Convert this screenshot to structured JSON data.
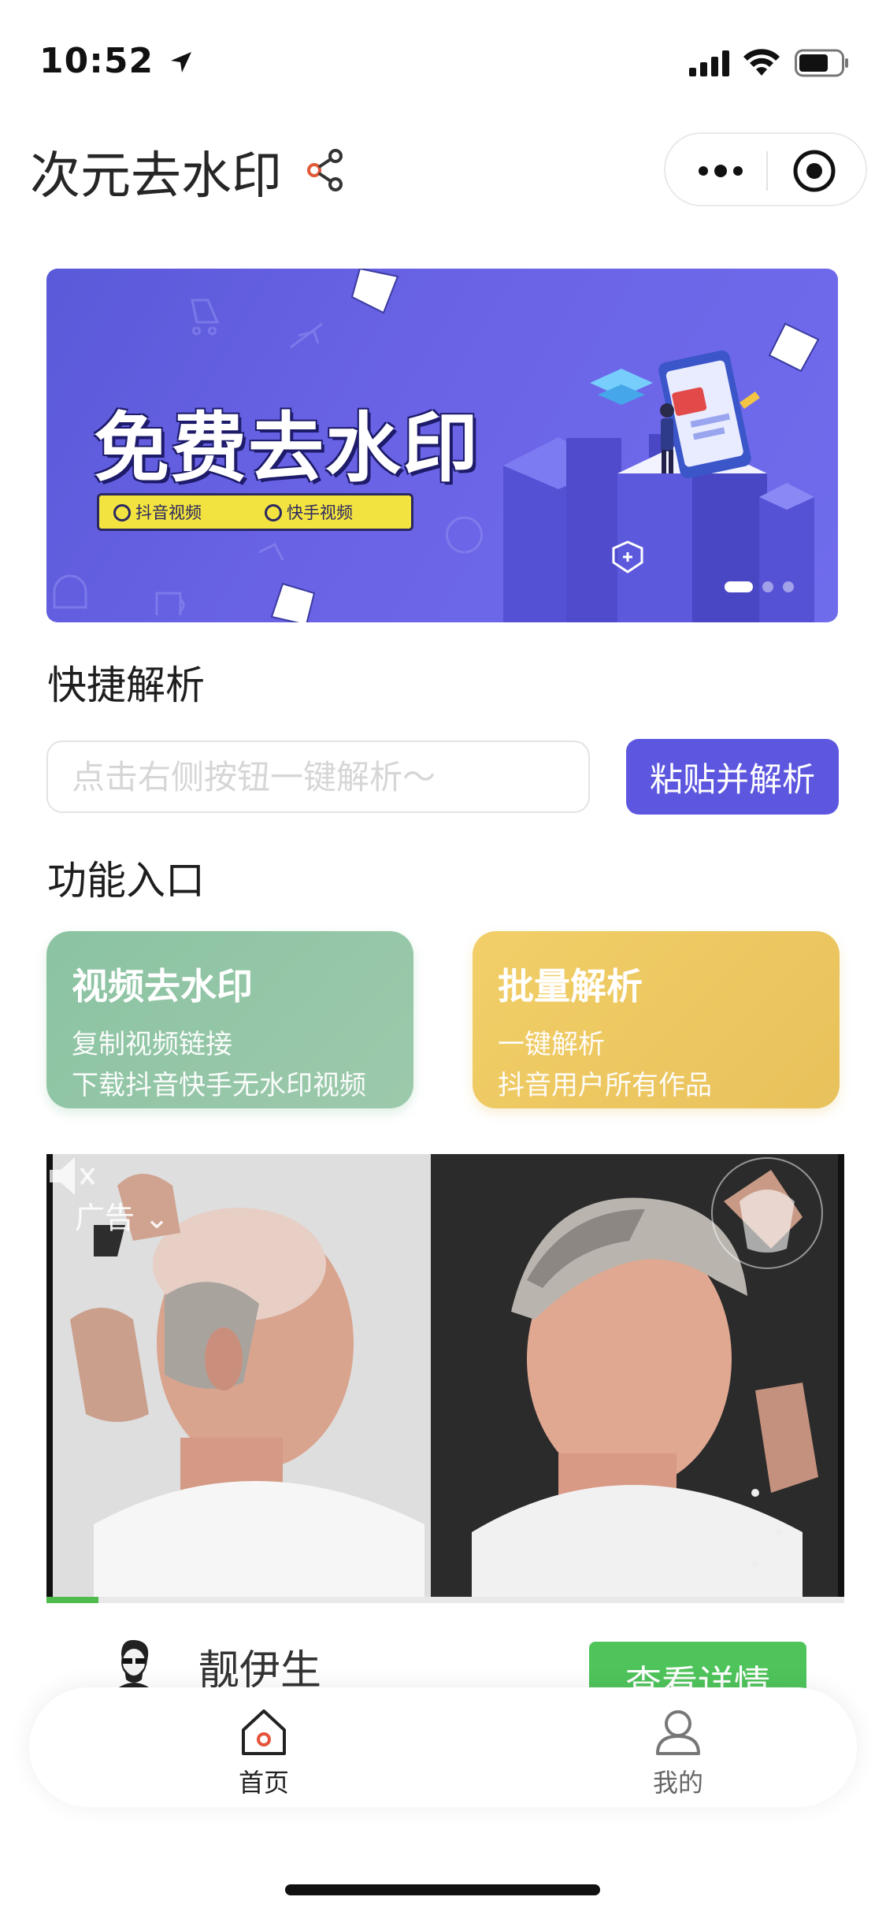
{
  "status_bar": {
    "time": "10:52"
  },
  "header": {
    "title": "次元去水印"
  },
  "banner": {
    "headline": "免费去水印",
    "tags": [
      "抖音视频",
      "快手视频"
    ],
    "slide_count": 3,
    "active_slide": 1
  },
  "quick_parse": {
    "section_title": "快捷解析",
    "input_placeholder": "点击右侧按钮一键解析～",
    "input_value": "",
    "button_label": "粘贴并解析",
    "accent_color": "#5d57e0"
  },
  "features": {
    "section_title": "功能入口",
    "cards": [
      {
        "title": "视频去水印",
        "lines": [
          "复制视频链接",
          "下载抖音快手无水印视频"
        ],
        "color": "#8bc3a2"
      },
      {
        "title": "批量解析",
        "lines": [
          "一键解析",
          "抖音用户所有作品"
        ],
        "color": "#f2cf68"
      }
    ]
  },
  "ad": {
    "label": "广告",
    "progress": 0.065,
    "advertiser_name": "靓伊生",
    "cta_label": "查看详情",
    "cta_color": "#4fc45b"
  },
  "tabbar": {
    "tabs": [
      {
        "label": "首页",
        "icon": "home-icon",
        "active": true
      },
      {
        "label": "我的",
        "icon": "user-icon",
        "active": false
      }
    ]
  }
}
